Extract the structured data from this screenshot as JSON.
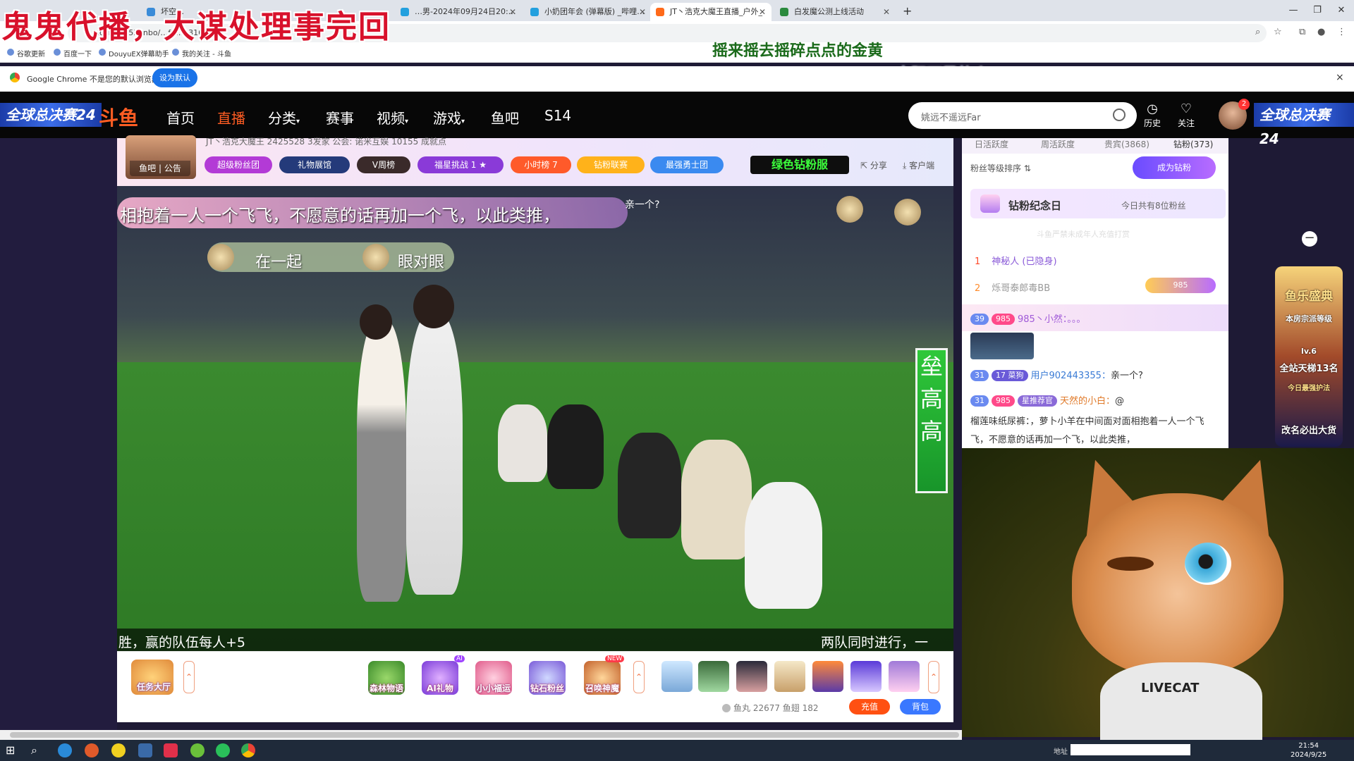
{
  "banner_title": "鬼鬼代播，大谋处理事完回",
  "lyrics": [
    "摇来摇去摇碎点点的金黄",
    "太阳下是故乡"
  ],
  "browser": {
    "tabs": [
      {
        "label": "坏空…",
        "active": false
      },
      {
        "label": "…男-2024年09月24日20:…",
        "active": false
      },
      {
        "label": "小奶团年会 (弹幕版) _哔哩…",
        "active": false
      },
      {
        "label": "JT丶浩克大魔王直播_户外_",
        "active": true
      },
      {
        "label": "白发魔公测上线活动",
        "active": false
      }
    ],
    "url": "…com/9853anbo/…fb…031601",
    "bookmarks": [
      "谷歌更新",
      "百度一下",
      "DouyuEX弹幕助手",
      "我的关注 - 斗鱼"
    ],
    "infobar_text": "Google Chrome 不是您的默认浏览器",
    "infobar_button": "设为默认",
    "close_glyph": "×"
  },
  "header": {
    "event_badge_left": "全球总决赛24",
    "event_badge_right": "全球总决赛24",
    "logo": "斗鱼",
    "nav": [
      {
        "label": "首页",
        "active": false
      },
      {
        "label": "直播",
        "active": true
      },
      {
        "label": "分类",
        "active": false,
        "dropdown": true
      },
      {
        "label": "赛事",
        "active": false
      },
      {
        "label": "视频",
        "active": false,
        "dropdown": true
      },
      {
        "label": "游戏",
        "active": false,
        "dropdown": true
      },
      {
        "label": "鱼吧",
        "active": false
      },
      {
        "label": "S14",
        "active": false
      }
    ],
    "search_value": "姚远不遥远Far",
    "history_label": "历史",
    "follow_label": "关注",
    "avatar_badge": "2"
  },
  "room": {
    "tabs": "鱼吧 | 公告",
    "info": "JT丶浩克大魔王   2425528   3发家   公会: 诺米互娱   10155 成就点",
    "pills": [
      {
        "label": "超级粉丝团",
        "color": "#b33ad6"
      },
      {
        "label": "礼物展馆",
        "color": "#243a7a"
      },
      {
        "label": "V周榜",
        "color": "#3a2a2a"
      },
      {
        "label": "福星挑战 1 ★",
        "color": "#8a3ad8"
      },
      {
        "label": "小时榜 7",
        "color": "#ff5a2a"
      },
      {
        "label": "钻粉联赛",
        "color": "#ffb21a"
      },
      {
        "label": "最强勇士团",
        "color": "#3a8af0"
      }
    ],
    "green_pill": "绿色钻粉服",
    "share": "分享",
    "client": "客户端"
  },
  "video": {
    "caption": "相抱着一人一个飞飞，不愿意的话再加一个飞，以此类推，",
    "caption_tail": "亲一个?",
    "labels": [
      "在一起",
      "眼对眼"
    ],
    "side_banner": "垒高高",
    "bottom_left": "胜，赢的队伍每人+5",
    "bottom_right": "两队同时进行，一"
  },
  "gifts": {
    "task_hall": "任务大厅",
    "items": [
      "森林物语",
      "AI礼物",
      "小小福运",
      "钻石粉丝",
      "召唤神魔"
    ],
    "ai_tag": "AI",
    "new_tag": "NEW",
    "currency": "鱼丸 22677   鱼翅 182",
    "recharge": "充值",
    "backpack": "背包"
  },
  "rank_panel": {
    "tabs": [
      "日活跃度",
      "周活跃度",
      "贵宾(3868)",
      "钻粉(373)"
    ],
    "fan_sort": "粉丝等级排序 ⇅",
    "become_diamond": "成为钻粉",
    "memorial_title": "钻粉纪念日",
    "memorial_note": "今日共有8位粉丝",
    "memorial_hint": "斗鱼严禁未成年人充值打赏",
    "ranks": [
      {
        "num": "1",
        "name": "神秘人 (已隐身)"
      },
      {
        "num": "2",
        "name": "烁哥泰郎毒BB"
      }
    ],
    "rank2_level": "985"
  },
  "chat": [
    {
      "level": "39",
      "badge": "985",
      "user": "985丶小然：",
      "text": "。。。"
    },
    {
      "level": "31",
      "badge": "17 菜狗",
      "user": "用户902443355：",
      "text": "亲一个?"
    },
    {
      "level": "31",
      "badge": "985",
      "user": "天然的小白：",
      "text": "@"
    }
  ],
  "chat_long": "榴莲味纸尿裤：，萝卜小羊在中间面对面相抱着一人一个飞飞，不愿意的话再加一个飞，以此类推，",
  "chat_extra_badge": "星推荐官",
  "cat_shirt": "LIVECAT",
  "side_widget": {
    "title": "鱼乐盛典",
    "sub": "本房宗派等级",
    "level": "lv.6",
    "rank": "全站天梯13名",
    "guard": "今日最强护法",
    "rename": "改名必出大货"
  },
  "taskbar": {
    "addr_label": "地址",
    "time": "21:54",
    "date": "2024/9/25"
  }
}
